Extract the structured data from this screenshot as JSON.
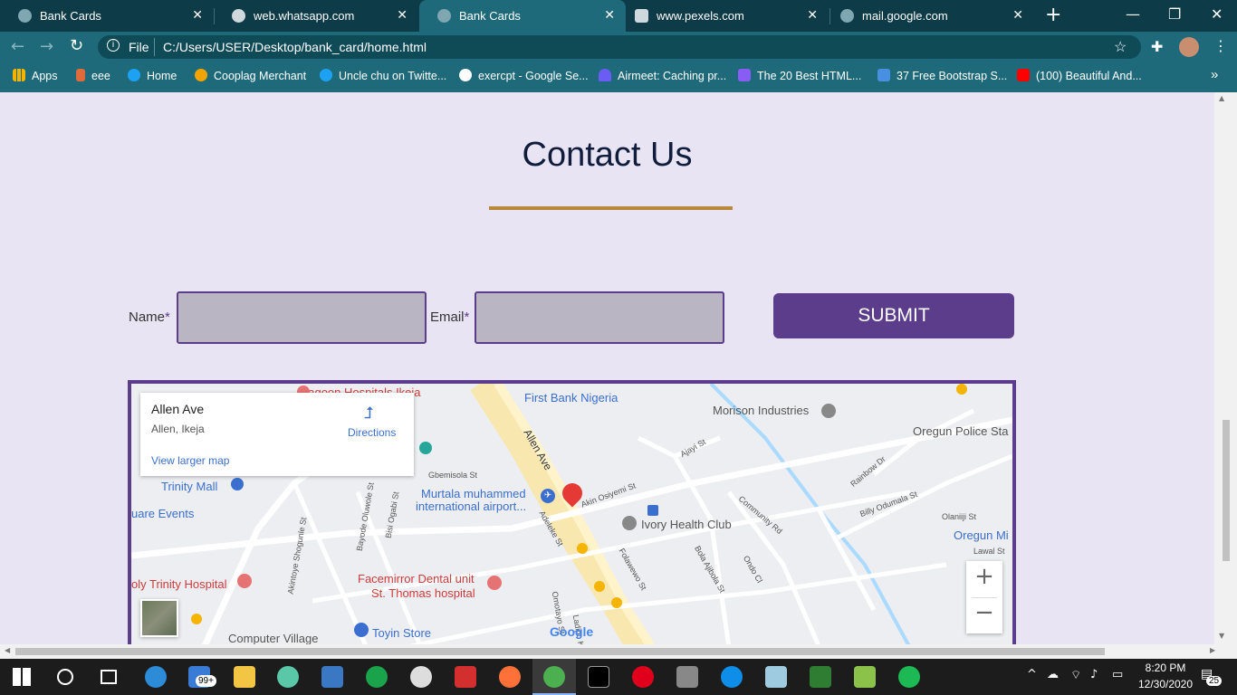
{
  "browser": {
    "tabs": [
      {
        "title": "Bank Cards",
        "active": false
      },
      {
        "title": "web.whatsapp.com",
        "active": false
      },
      {
        "title": "Bank Cards",
        "active": true
      },
      {
        "title": "www.pexels.com",
        "active": false
      },
      {
        "title": "mail.google.com",
        "active": false
      }
    ],
    "url_scheme": "File",
    "url": "C:/Users/USER/Desktop/bank_card/home.html",
    "bookmarks": [
      "Apps",
      "eee",
      "Home",
      "Cooplag Merchant",
      "Uncle chu on Twitte...",
      "exercpt - Google Se...",
      "Airmeet: Caching pr...",
      "The 20 Best HTML...",
      "37 Free Bootstrap S...",
      "(100) Beautiful And..."
    ],
    "colors": {
      "tabbar": "#0e3b48",
      "toolbar": "#1f6a7a"
    }
  },
  "page": {
    "title": "Contact Us",
    "form": {
      "name_label": "Name",
      "email_label": "Email",
      "required_mark": "*",
      "submit_label": "SUBMIT"
    },
    "colors": {
      "background": "#e9e4f3",
      "accent": "#5b3d8c",
      "divider": "#b8893a",
      "title": "#101c3c"
    }
  },
  "map": {
    "place_name": "Allen Ave",
    "place_address": "Allen, Ikeja",
    "directions_label": "Directions",
    "larger_map_label": "View larger map",
    "labels": [
      "Lagoon Hospitals Ikeja",
      "First Bank Nigeria",
      "Morison Industries",
      "Oregun Police Sta",
      "Trinity Mall",
      "uare Events",
      "Murtala muhammed",
      "international airport...",
      "Ivory Health Club",
      "Akin Osiyemi St",
      "Allen Ave",
      "Gbemisola St",
      "Ajayi St",
      "Rainbow Dr",
      "Billy Odumala St",
      "Olaniiji St",
      "Oregun Mi",
      "Lawal St",
      "Community Rd",
      "Bola Ajibola St",
      "Ondo Cl",
      "Folawewo St",
      "Adeleke St",
      "Bayode Oluwole St",
      "Bisi Ogabi St",
      "Akintoye Shogunle St",
      "oly Trinity Hospital",
      "Facemirror Dental unit",
      "St. Thomas hospital",
      "Toyin Store",
      "Computer Village",
      "Omotayo St",
      "Ladipo K"
    ],
    "zoom_in": "+",
    "zoom_out": "−",
    "google_logo": "Google"
  },
  "taskbar": {
    "time": "8:20 PM",
    "date": "12/30/2020",
    "mail_badge": "99+",
    "notification_count": "25"
  }
}
